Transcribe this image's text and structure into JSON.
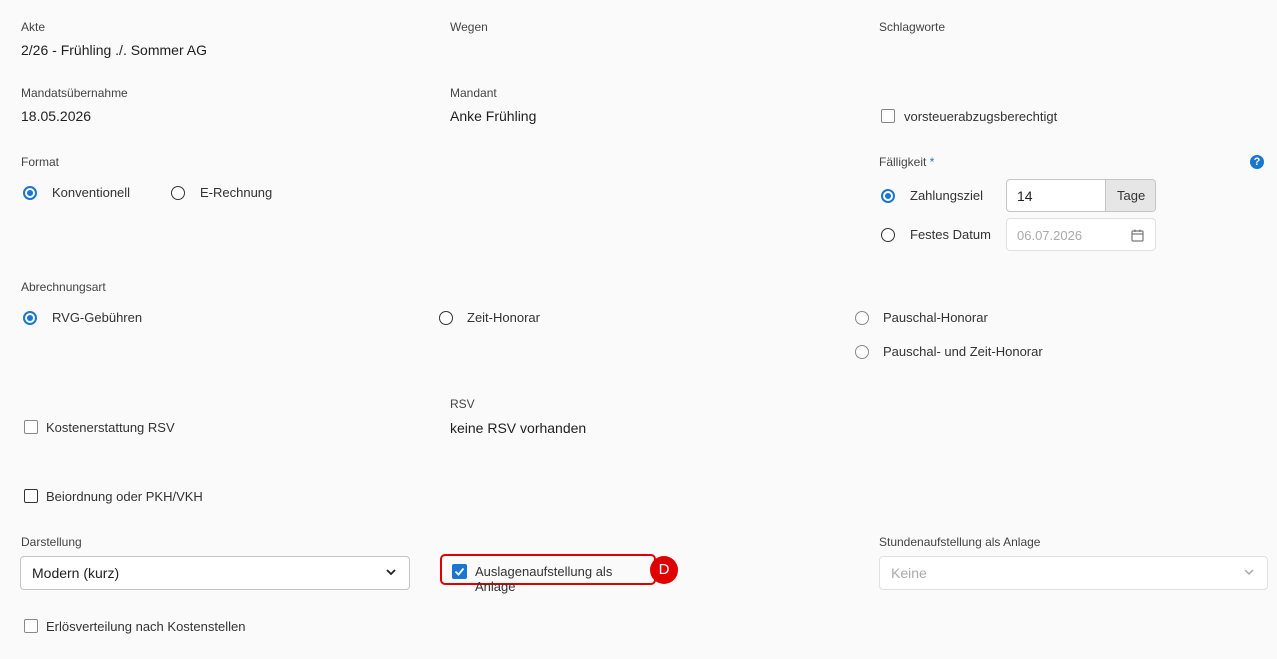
{
  "akte": {
    "label": "Akte",
    "value": "2/26 - Frühling ./. Sommer AG"
  },
  "wegen": {
    "label": "Wegen"
  },
  "schlagworte": {
    "label": "Schlagworte"
  },
  "mandatsuebernahme": {
    "label": "Mandatsübernahme",
    "value": "18.05.2026"
  },
  "mandant": {
    "label": "Mandant",
    "value": "Anke Frühling"
  },
  "vorsteuer": {
    "label": "vorsteuerabzugsberechtigt",
    "checked": false
  },
  "format": {
    "label": "Format",
    "options": [
      {
        "label": "Konventionell",
        "selected": true
      },
      {
        "label": "E-Rechnung",
        "selected": false
      }
    ]
  },
  "faelligkeit": {
    "label": "Fälligkeit",
    "required_marker": "*",
    "help_icon": "question-circle-icon",
    "zahlungsziel": {
      "label": "Zahlungsziel",
      "selected": true,
      "value": "14",
      "unit": "Tage"
    },
    "festes_datum": {
      "label": "Festes Datum",
      "selected": false,
      "placeholder": "06.07.2026",
      "icon": "calendar-icon"
    }
  },
  "abrechnungsart": {
    "label": "Abrechnungsart",
    "options": [
      {
        "label": "RVG-Gebühren",
        "selected": true
      },
      {
        "label": "Zeit-Honorar",
        "selected": false
      },
      {
        "label": "Pauschal-Honorar",
        "selected": false,
        "disabled": true
      },
      {
        "label": "Pauschal- und Zeit-Honorar",
        "selected": false,
        "disabled": true
      }
    ]
  },
  "kostenerstattung": {
    "label": "Kostenerstattung RSV",
    "checked": false
  },
  "rsv": {
    "label": "RSV",
    "value": "keine RSV vorhanden"
  },
  "beiordnung": {
    "label": "Beiordnung oder PKH/VKH",
    "checked": false
  },
  "darstellung": {
    "label": "Darstellung",
    "value": "Modern (kurz)"
  },
  "auslagen": {
    "label": "Auslagenaufstellung als Anlage",
    "checked": true,
    "badge": "D",
    "highlight_color": "#e00000"
  },
  "stunden": {
    "label": "Stundenaufstellung als Anlage",
    "value": "Keine"
  },
  "erloes": {
    "label": "Erlösverteilung nach Kostenstellen",
    "checked": false
  },
  "colors": {
    "accent": "#1976d2",
    "badge": "#e00000"
  }
}
